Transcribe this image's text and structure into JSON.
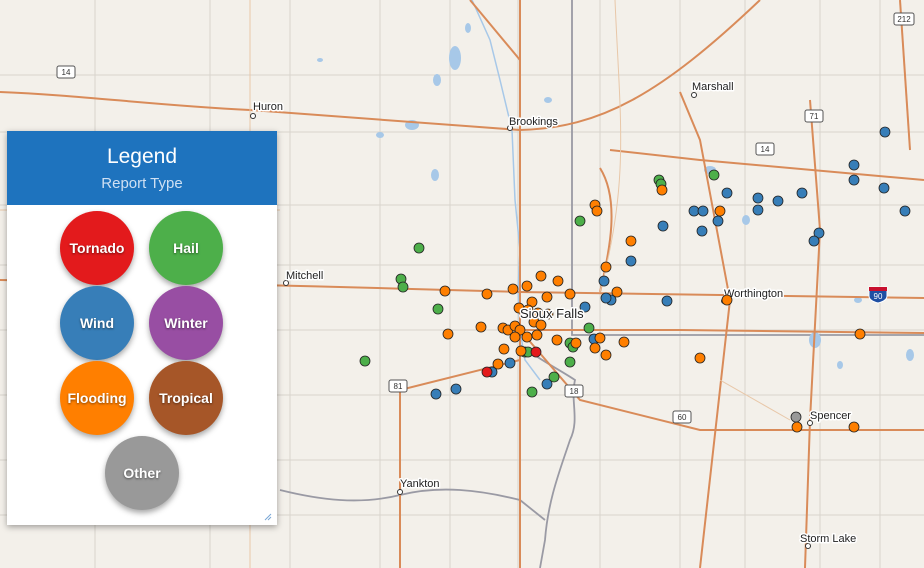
{
  "legend": {
    "title": "Legend",
    "subtitle": "Report Type",
    "types": [
      {
        "key": "tornado",
        "label": "Tornado",
        "color": "#e31a1c"
      },
      {
        "key": "hail",
        "label": "Hail",
        "color": "#4daf4a"
      },
      {
        "key": "wind",
        "label": "Wind",
        "color": "#377eb8"
      },
      {
        "key": "winter",
        "label": "Winter",
        "color": "#984ea3"
      },
      {
        "key": "flooding",
        "label": "Flooding",
        "color": "#ff7f00"
      },
      {
        "key": "tropical",
        "label": "Tropical",
        "color": "#a65628"
      },
      {
        "key": "other",
        "label": "Other",
        "color": "#999999"
      }
    ]
  },
  "map": {
    "cities": [
      "Huron",
      "Brookings",
      "Marshall",
      "Mitchell",
      "Sioux Falls",
      "Worthington",
      "Spencer",
      "Yankton",
      "Storm Lake"
    ],
    "highway_shields": [
      "14",
      "212",
      "71",
      "14",
      "90",
      "81",
      "18",
      "60"
    ]
  }
}
